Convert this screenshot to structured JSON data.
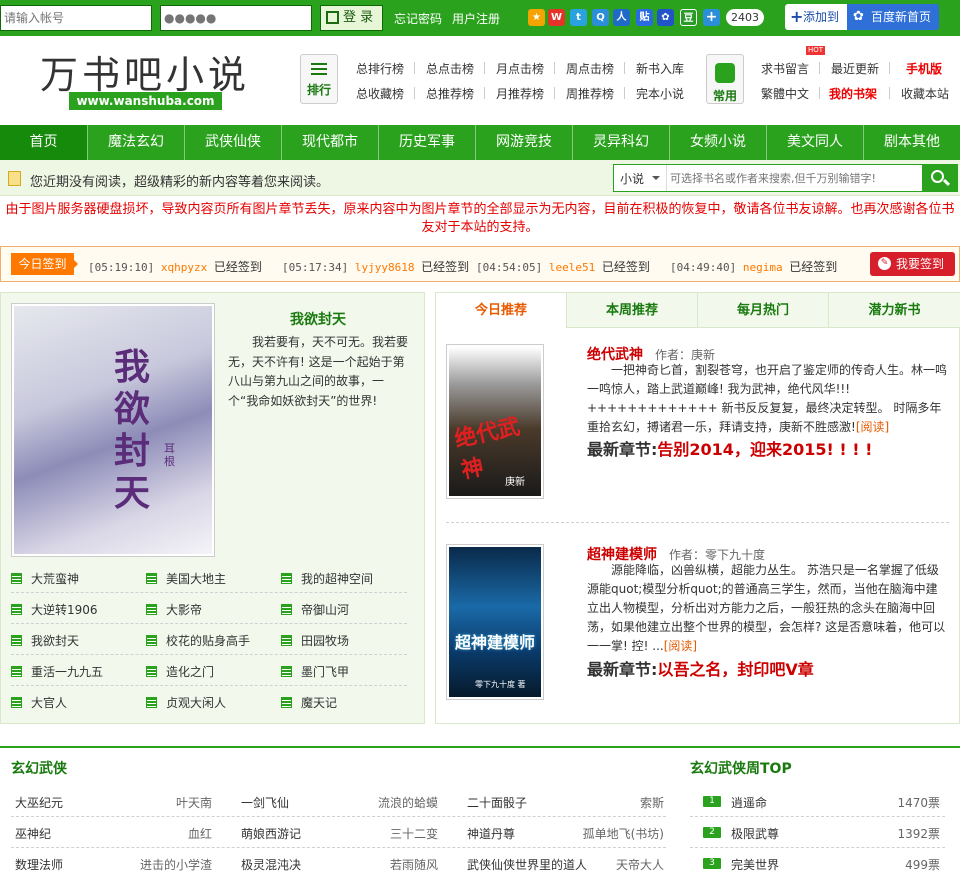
{
  "topbar": {
    "account_placeholder": "请输入帐号",
    "password_placeholder": "●●●●●",
    "login_label": "登 录",
    "forgot_label": "忘记密码",
    "register_label": "用户注册",
    "share_count": "2403",
    "add_label": "添加到",
    "baidu_label": "百度新首页"
  },
  "header": {
    "logo_text": "万书吧小说",
    "logo_url": "www.wanshuba.com",
    "rank_label": "排行",
    "common_label": "常用",
    "hot_badge": "HOT",
    "rank_links": [
      [
        "总排行榜",
        "总点击榜",
        "月点击榜",
        "周点击榜",
        "新书入库"
      ],
      [
        "总收藏榜",
        "总推荐榜",
        "月推荐榜",
        "周推荐榜",
        "完本小说"
      ]
    ],
    "common_links": [
      [
        "求书留言",
        "最近更新",
        "手机版"
      ],
      [
        "繁體中文",
        "我的书架",
        "收藏本站"
      ]
    ]
  },
  "nav": [
    "首页",
    "魔法玄幻",
    "武侠仙侠",
    "现代都市",
    "历史军事",
    "网游竞技",
    "灵异科幻",
    "女频小说",
    "美文同人",
    "剧本其他"
  ],
  "notice": {
    "text": "您近期没有阅读，超级精彩的新内容等着您来阅读。",
    "search_type": "小说",
    "search_placeholder": "可选择书名或作者来搜索,但千万别输错字!"
  },
  "warning": "由于图片服务器硬盘损坏，导致内容页所有图片章节丢失，原来内容中为图片章节的全部显示为无内容，目前在积极的恢复中，敬请各位书友谅解。也再次感谢各位书友对于本站的支持。",
  "signin": {
    "label": "今日签到",
    "status": "已经签到",
    "button": "我要签到",
    "entries": [
      {
        "time": "[05:19:10]",
        "user": "xqhpyzx"
      },
      {
        "time": "[05:17:34]",
        "user": "lyjyy8618"
      },
      {
        "time": "[04:54:05]",
        "user": "leele51"
      },
      {
        "time": "[04:49:40]",
        "user": "negima"
      }
    ]
  },
  "featured": {
    "title": "我欲封天",
    "desc": "我若要有，天不可无。我若要无，天不许有! 这是一个起始于第八山与第九山之间的故事，一个“我命如妖欲封天”的世界!",
    "cover_title": "我欲封天",
    "cover_author": "耳根",
    "books": [
      "大荒蛮神",
      "美国大地主",
      "我的超神空间",
      "大逆转1906",
      "大影帝",
      "帝御山河",
      "我欲封天",
      "校花的贴身高手",
      "田园牧场",
      "重活一九九五",
      "造化之门",
      "墨门飞甲",
      "大官人",
      "贞观大闲人",
      "魔天记"
    ]
  },
  "tabs": [
    "今日推荐",
    "本周推荐",
    "每月热门",
    "潜力新书"
  ],
  "recommend": [
    {
      "title": "绝代武神",
      "author_label": "作者：庚新",
      "desc": "一把神奇匕首，割裂苍穹，也开启了鉴定师的传奇人生。林一鸣一鸣惊人，踏上武道巅峰! 我为武神，绝代风华!!! +++++++++++++ 新书反反复复，最终决定转型。 时隔多年重拾玄幻，搏诸君一乐，拜请支持，庚新不胜感激!",
      "read": "[阅读]",
      "latest_label": "最新章节:",
      "latest": "告别2014，迎来2015! ! ! !",
      "cover_title": "绝代武神",
      "cover_author": "庚新"
    },
    {
      "title": "超神建模师",
      "author_label": "作者：零下九十度",
      "desc": "源能降临，凶兽纵横，超能力丛生。 苏浩只是一名掌握了低级源能quot;模型分析quot;的普通高三学生，然而，当他在脑海中建立出人物模型，分析出对方能力之后，一般狂热的念头在脑海中回荡，如果他建立出整个世界的模型，会怎样? 这是否意味着，他可以一一掌! 控! ...",
      "read": "[阅读]",
      "latest_label": "最新章节:",
      "latest": "以吾之名，封印吧V章",
      "cover_title": "超神建模师",
      "cover_author": "零下九十度 著"
    }
  ],
  "bottom": {
    "section_title": "玄幻武侠",
    "top_title": "玄幻武侠周TOP",
    "rows": [
      [
        {
          "b": "大巫纪元",
          "a": "叶天南"
        },
        {
          "b": "一剑飞仙",
          "a": "流浪的蛤蟆"
        },
        {
          "b": "二十面骰子",
          "a": "索斯"
        }
      ],
      [
        {
          "b": "巫神纪",
          "a": "血红"
        },
        {
          "b": "萌娘西游记",
          "a": "三十二变"
        },
        {
          "b": "神道丹尊",
          "a": "孤单地飞(书坊)"
        }
      ],
      [
        {
          "b": "数理法师",
          "a": "进击的小学渣"
        },
        {
          "b": "极灵混沌决",
          "a": "若雨随风"
        },
        {
          "b": "武侠仙侠世界里的道人",
          "a": "天帝大人"
        }
      ]
    ],
    "top": [
      {
        "rank": "1",
        "title": "逍遥命",
        "votes": "1470票"
      },
      {
        "rank": "2",
        "title": "极限武尊",
        "votes": "1392票"
      },
      {
        "rank": "3",
        "title": "完美世界",
        "votes": "499票"
      }
    ]
  },
  "colors": {
    "brand": "#2ba21e",
    "accent": "#e85a00",
    "alert": "#e60000"
  }
}
